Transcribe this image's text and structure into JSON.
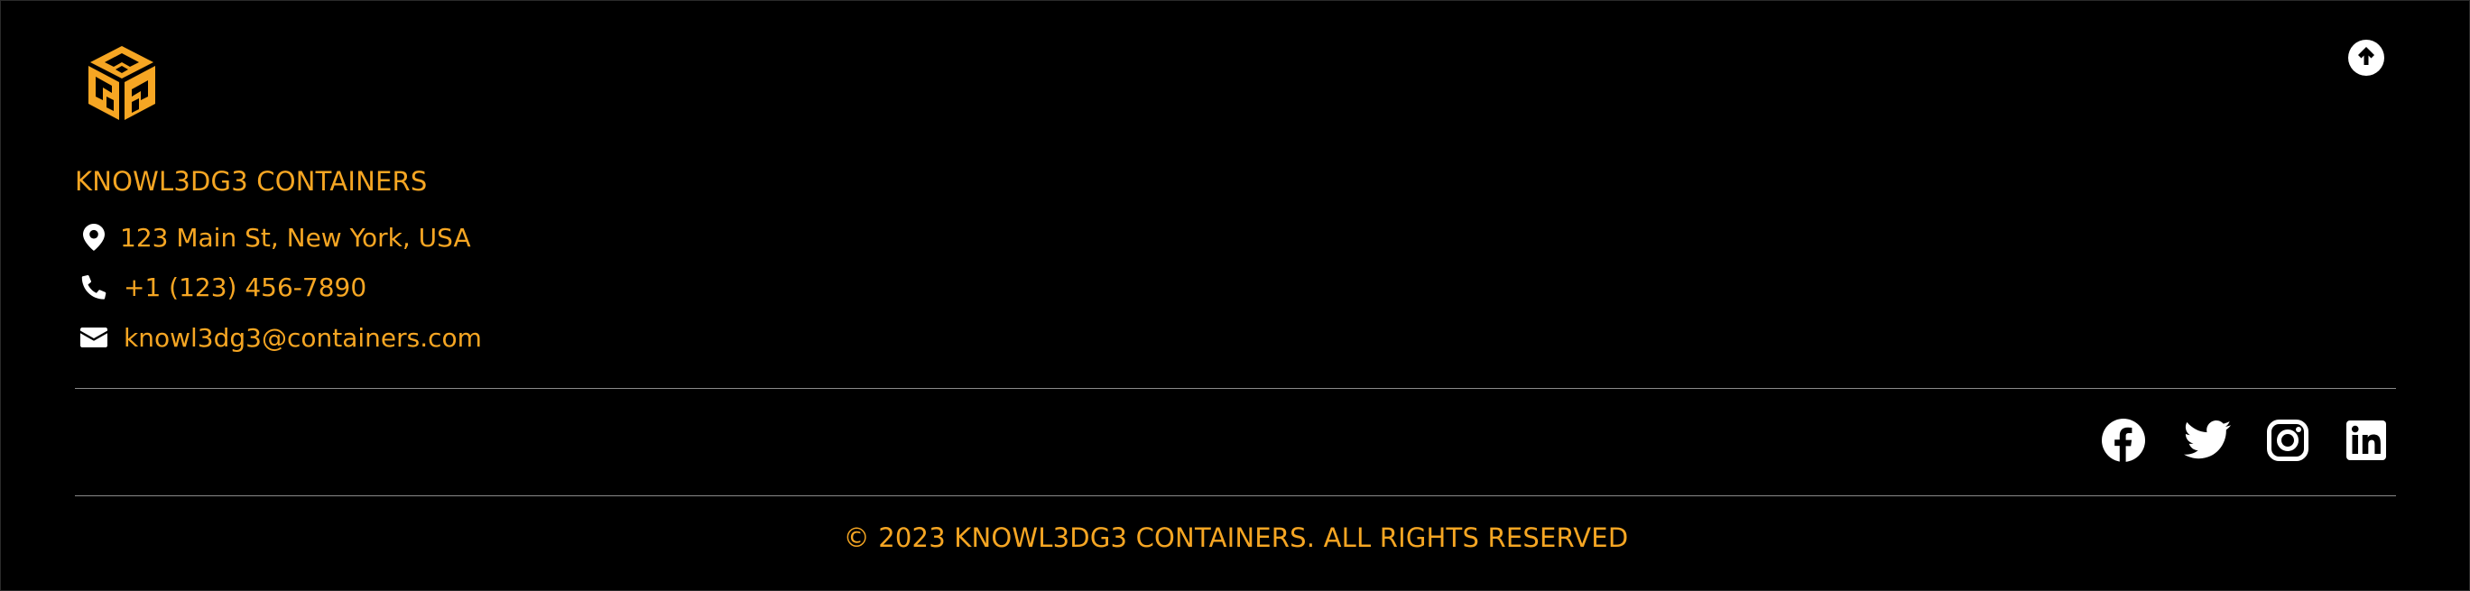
{
  "brand": {
    "name": "KNOWL3DG3 CONTAINERS",
    "logo_icon": "cube-logo-icon"
  },
  "contact": {
    "address": "123 Main St, New York, USA",
    "phone": "+1 (123) 456-7890",
    "email": "knowl3dg3@containers.com"
  },
  "social": [
    {
      "name": "facebook",
      "icon": "facebook-icon"
    },
    {
      "name": "twitter",
      "icon": "twitter-icon"
    },
    {
      "name": "instagram",
      "icon": "instagram-icon"
    },
    {
      "name": "linkedin",
      "icon": "linkedin-icon"
    }
  ],
  "back_to_top_icon": "arrow-up-circle-icon",
  "copyright": "© 2023 KNOWL3DG3 CONTAINERS. ALL RIGHTS RESERVED",
  "colors": {
    "background": "#000000",
    "accent": "#f6a623",
    "icon": "#ffffff",
    "divider": "#8a8a8a"
  }
}
